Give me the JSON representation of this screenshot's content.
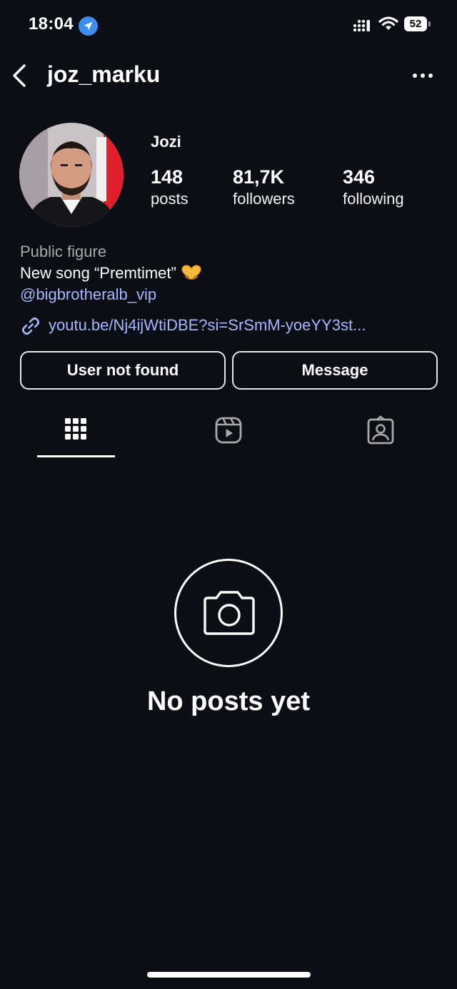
{
  "status_bar": {
    "time": "18:04",
    "battery": "52",
    "icons": [
      "location-arrow-icon",
      "signal-icon",
      "wifi-icon",
      "battery-icon"
    ]
  },
  "header": {
    "username": "joz_marku",
    "back_icon": "chevron-left-icon",
    "more_icon": "ellipsis-icon"
  },
  "profile": {
    "display_name": "Jozi",
    "stats": [
      {
        "number": "148",
        "label": "posts"
      },
      {
        "number": "81,7K",
        "label": "followers"
      },
      {
        "number": "346",
        "label": "following"
      }
    ],
    "category": "Public figure",
    "bio": "New song “Premtimet”",
    "bio_emoji": "heart-hands-emoji",
    "mention": "@bigbrotheralb_vip",
    "link": "youtu.be/Nj4ijWtiDBE?si=SrSmM-yoeYY3st..."
  },
  "actions": {
    "primary": "User not found",
    "secondary": "Message"
  },
  "tabs": [
    {
      "icon": "grid-icon",
      "active": true
    },
    {
      "icon": "reels-icon",
      "active": false
    },
    {
      "icon": "tagged-icon",
      "active": false
    }
  ],
  "empty_state": {
    "icon": "camera-icon",
    "title": "No posts yet"
  },
  "colors": {
    "background": "#0b0e14",
    "link": "#a8b6ff",
    "muted": "#a8a8a8",
    "accent_blue": "#3b8df2"
  }
}
